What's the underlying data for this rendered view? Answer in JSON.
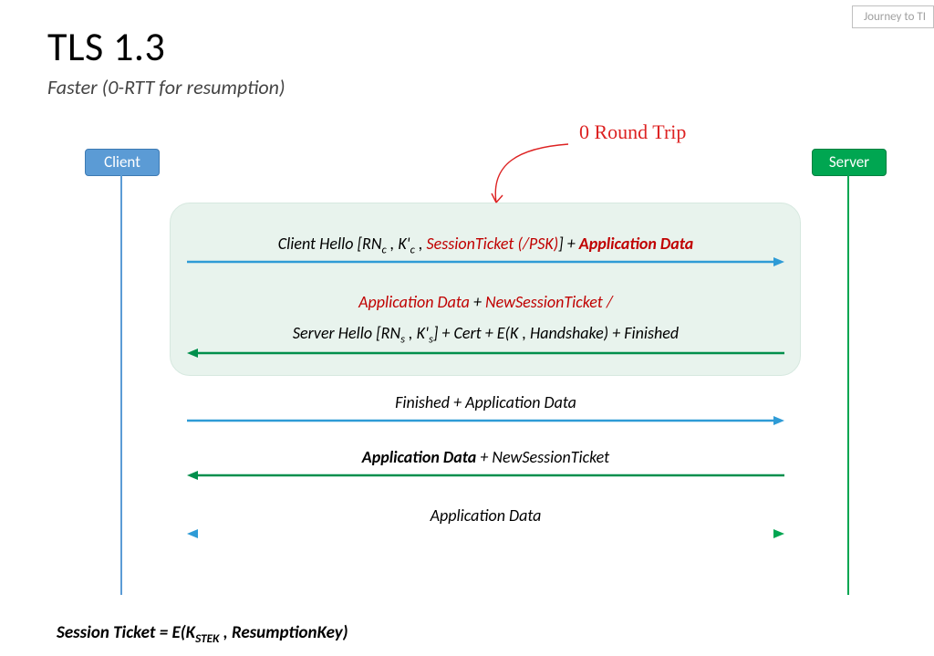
{
  "header_tag": "Journey to TI",
  "title": "TLS 1.3",
  "subtitle": "Faster (0-RTT for resumption)",
  "client_label": "Client",
  "server_label": "Server",
  "annotation": "0 Round Trip",
  "msg1": {
    "prefix": "Client Hello [RN",
    "sub1": "c",
    "mid1": " , K'",
    "sub2": "c",
    "mid2": " , ",
    "red": "SessionTicket (/PSK)",
    "mid3": "] + ",
    "redbold": "Application Data"
  },
  "msg2a": {
    "red1": "Application Data",
    "plus": " + ",
    "red2": "NewSessionTicket /"
  },
  "msg2b": {
    "prefix": "Server Hello [RN",
    "sub1": "s",
    "mid1": " , K'",
    "sub2": "s",
    "tail": "] + Cert + E(K , Handshake) + Finished"
  },
  "msg3": "Finished + Application Data",
  "msg4": {
    "bold": "Application Data",
    "rest": " + NewSessionTicket"
  },
  "msg5": "Application Data",
  "footnote": {
    "prefix": "Session Ticket = E(K",
    "sub": "STEK",
    "tail": " , ResumptionKey)"
  },
  "colors": {
    "blue": "#2e9bd6",
    "green": "#008f4c",
    "red": "#c00000"
  }
}
